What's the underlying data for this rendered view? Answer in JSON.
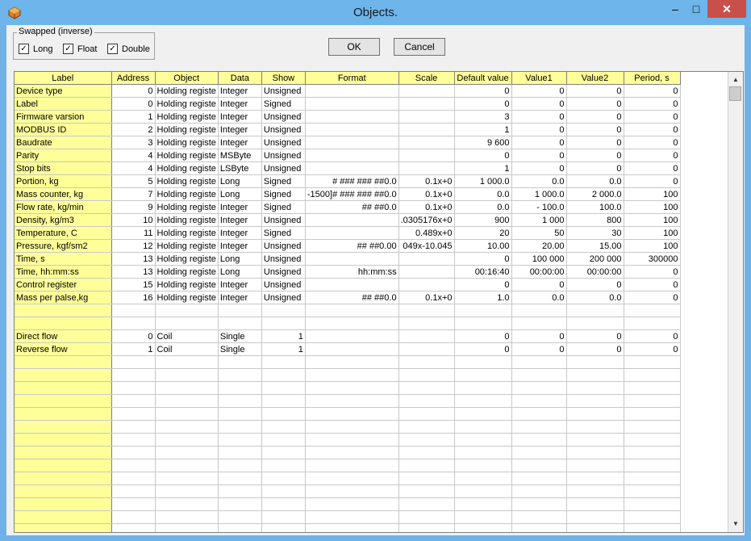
{
  "window": {
    "title": "Objects."
  },
  "titlebar_buttons": {
    "minimize": "–",
    "maximize": "□",
    "close": "✕"
  },
  "swapped": {
    "title": "Swapped (inverse)",
    "checkboxes": [
      {
        "label": "Long",
        "checked": true
      },
      {
        "label": "Float",
        "checked": true
      },
      {
        "label": "Double",
        "checked": true
      }
    ]
  },
  "buttons": {
    "ok": "OK",
    "cancel": "Cancel"
  },
  "table": {
    "columns": [
      "Label",
      "Address",
      "Object",
      "Data",
      "Show",
      "Format",
      "Scale",
      "Default value",
      "Value1",
      "Value2",
      "Period, s"
    ],
    "rows": [
      [
        "Device type",
        "0",
        "Holding registe",
        "Integer",
        "Unsigned",
        "",
        "",
        "0",
        "0",
        "0",
        "0"
      ],
      [
        "Label",
        "0",
        "Holding registe",
        "Integer",
        "Signed",
        "",
        "",
        "0",
        "0",
        "0",
        "0"
      ],
      [
        "Firmware varsion",
        "1",
        "Holding registe",
        "Integer",
        "Unsigned",
        "",
        "",
        "3",
        "0",
        "0",
        "0"
      ],
      [
        "MODBUS ID",
        "2",
        "Holding registe",
        "Integer",
        "Unsigned",
        "",
        "",
        "1",
        "0",
        "0",
        "0"
      ],
      [
        "Baudrate",
        "3",
        "Holding registe",
        "Integer",
        "Unsigned",
        "",
        "",
        "9 600",
        "0",
        "0",
        "0"
      ],
      [
        "Parity",
        "4",
        "Holding registe",
        "MSByte",
        "Unsigned",
        "",
        "",
        "0",
        "0",
        "0",
        "0"
      ],
      [
        "Stop bits",
        "4",
        "Holding registe",
        "LSByte",
        "Unsigned",
        "",
        "",
        "1",
        "0",
        "0",
        "0"
      ],
      [
        "Portion, kg",
        "5",
        "Holding registe",
        "Long",
        "Signed",
        "# ### ### ##0.0",
        "0.1x+0",
        "1 000.0",
        "0.0",
        "0.0",
        "0"
      ],
      [
        "Mass counter, kg",
        "7",
        "Holding registe",
        "Long",
        "Signed",
        "-1500]# ### ### ##0.0",
        "0.1x+0",
        "0.0",
        "1 000.0",
        "2 000.0",
        "100"
      ],
      [
        "Flow rate, kg/min",
        "9",
        "Holding registe",
        "Integer",
        "Signed",
        "## ##0.0",
        "0.1x+0",
        "0.0",
        "- 100.0",
        "100.0",
        "100"
      ],
      [
        "Density, kg/m3",
        "10",
        "Holding registe",
        "Integer",
        "Unsigned",
        "",
        ".0305176x+0",
        "900",
        "1 000",
        "800",
        "100"
      ],
      [
        "Temperature, C",
        "11",
        "Holding registe",
        "Integer",
        "Signed",
        "",
        "0.489x+0",
        "20",
        "50",
        "30",
        "100"
      ],
      [
        "Pressure, kgf/sm2",
        "12",
        "Holding registe",
        "Integer",
        "Unsigned",
        "## ##0.00",
        "049x-10.045",
        "10.00",
        "20.00",
        "15.00",
        "100"
      ],
      [
        "Time, s",
        "13",
        "Holding registe",
        "Long",
        "Unsigned",
        "",
        "",
        "0",
        "100 000",
        "200 000",
        "300000"
      ],
      [
        "Time, hh:mm:ss",
        "13",
        "Holding registe",
        "Long",
        "Unsigned",
        "hh:mm:ss",
        "",
        "00:16:40",
        "00:00:00",
        "00:00:00",
        "0"
      ],
      [
        "Control register",
        "15",
        "Holding registe",
        "Integer",
        "Unsigned",
        "",
        "",
        "0",
        "0",
        "0",
        "0"
      ],
      [
        "Mass per palse,kg",
        "16",
        "Holding registe",
        "Integer",
        "Unsigned",
        "## ##0.0",
        "0.1x+0",
        "1.0",
        "0.0",
        "0.0",
        "0"
      ],
      [
        "",
        "",
        "",
        "",
        "",
        "",
        "",
        "",
        "",
        "",
        ""
      ],
      [
        "",
        "",
        "",
        "",
        "",
        "",
        "",
        "",
        "",
        "",
        ""
      ],
      [
        "Direct flow",
        "0",
        "Coil",
        "Single",
        "1",
        "",
        "",
        "0",
        "0",
        "0",
        "0"
      ],
      [
        "Reverse flow",
        "1",
        "Coil",
        "Single",
        "1",
        "",
        "",
        "0",
        "0",
        "0",
        "0"
      ],
      [
        "",
        "",
        "",
        "",
        "",
        "",
        "",
        "",
        "",
        "",
        ""
      ],
      [
        "",
        "",
        "",
        "",
        "",
        "",
        "",
        "",
        "",
        "",
        ""
      ],
      [
        "",
        "",
        "",
        "",
        "",
        "",
        "",
        "",
        "",
        "",
        ""
      ],
      [
        "",
        "",
        "",
        "",
        "",
        "",
        "",
        "",
        "",
        "",
        ""
      ],
      [
        "",
        "",
        "",
        "",
        "",
        "",
        "",
        "",
        "",
        "",
        ""
      ],
      [
        "",
        "",
        "",
        "",
        "",
        "",
        "",
        "",
        "",
        "",
        ""
      ],
      [
        "",
        "",
        "",
        "",
        "",
        "",
        "",
        "",
        "",
        "",
        ""
      ],
      [
        "",
        "",
        "",
        "",
        "",
        "",
        "",
        "",
        "",
        "",
        ""
      ],
      [
        "",
        "",
        "",
        "",
        "",
        "",
        "",
        "",
        "",
        "",
        ""
      ],
      [
        "",
        "",
        "",
        "",
        "",
        "",
        "",
        "",
        "",
        "",
        ""
      ],
      [
        "",
        "",
        "",
        "",
        "",
        "",
        "",
        "",
        "",
        "",
        ""
      ],
      [
        "",
        "",
        "",
        "",
        "",
        "",
        "",
        "",
        "",
        "",
        ""
      ],
      [
        "",
        "",
        "",
        "",
        "",
        "",
        "",
        "",
        "",
        "",
        ""
      ],
      [
        "",
        "",
        "",
        "",
        "",
        "",
        "",
        "",
        "",
        "",
        ""
      ]
    ]
  },
  "scrollbar": {
    "up": "▲",
    "down": "▼"
  }
}
